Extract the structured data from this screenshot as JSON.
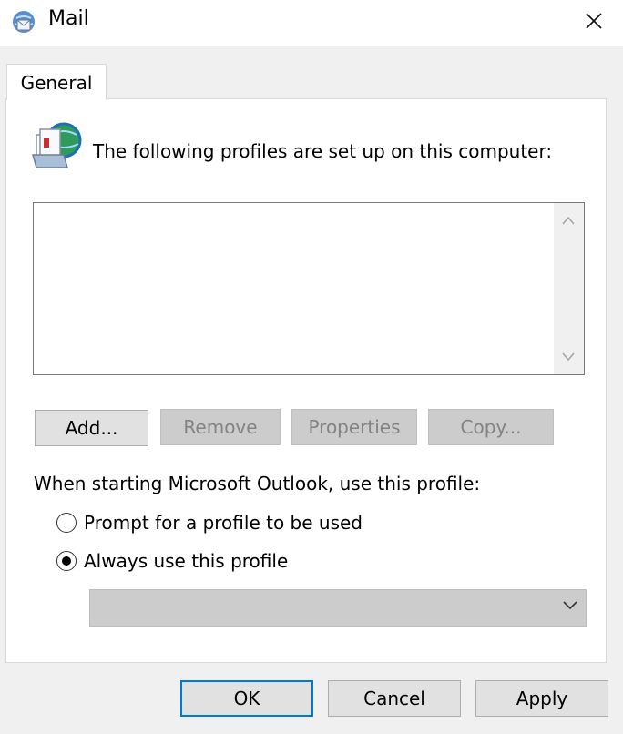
{
  "window": {
    "title": "Mail",
    "icon": "mail-globe-icon",
    "close_icon": "close-icon"
  },
  "tabs": [
    {
      "label": "General",
      "selected": true
    }
  ],
  "intro_text": "The following profiles are set up on this computer:",
  "profiles_list": {
    "items": []
  },
  "profile_buttons": {
    "add": {
      "label": "Add...",
      "enabled": true
    },
    "remove": {
      "label": "Remove",
      "enabled": false
    },
    "properties": {
      "label": "Properties",
      "enabled": false
    },
    "copy": {
      "label": "Copy...",
      "enabled": false
    }
  },
  "startup": {
    "label": "When starting Microsoft Outlook, use this profile:",
    "options": [
      {
        "label": "Prompt for a profile to be used",
        "selected": false
      },
      {
        "label": "Always use this profile",
        "selected": true
      }
    ],
    "profile_select": {
      "value": ""
    }
  },
  "footer": {
    "ok": "OK",
    "cancel": "Cancel",
    "apply": "Apply"
  },
  "colors": {
    "focus_border": "#0078d7",
    "disabled_bg": "#cccccc",
    "disabled_text": "#838383"
  }
}
